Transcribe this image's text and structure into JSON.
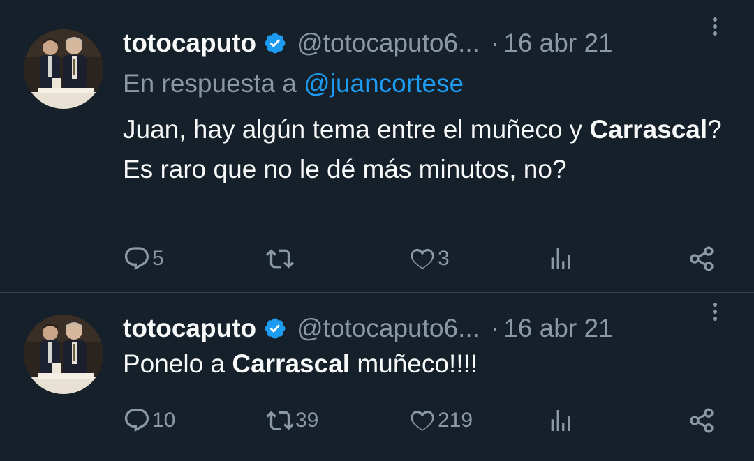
{
  "tweets": [
    {
      "name": "totocaputo",
      "handle": "@totocaputo6...",
      "date": "16 abr 21",
      "reply_prefix": "En respuesta a ",
      "reply_mention": "@juancortese",
      "text_parts": [
        "Juan, hay algún tema entre el muñeco y ",
        "Carrascal",
        "? Es raro que no le dé más minutos, no?"
      ],
      "replies": "5",
      "retweets": "",
      "likes": "3"
    },
    {
      "name": "totocaputo",
      "handle": "@totocaputo6...",
      "date": "16 abr 21",
      "text_parts": [
        "Ponelo a ",
        "Carrascal",
        " muñeco!!!!"
      ],
      "replies": "10",
      "retweets": "39",
      "likes": "219"
    }
  ],
  "colors": {
    "background": "#15202b",
    "text": "#f7f9f9",
    "muted": "#8b98a5",
    "accent": "#1d9bf0",
    "border": "#38444d"
  },
  "icons": {
    "verified": "verified-badge-icon",
    "more": "more-vertical-icon",
    "reply": "reply-bubble-icon",
    "retweet": "retweet-icon",
    "like": "heart-icon",
    "views": "analytics-bars-icon",
    "share": "share-icon"
  }
}
